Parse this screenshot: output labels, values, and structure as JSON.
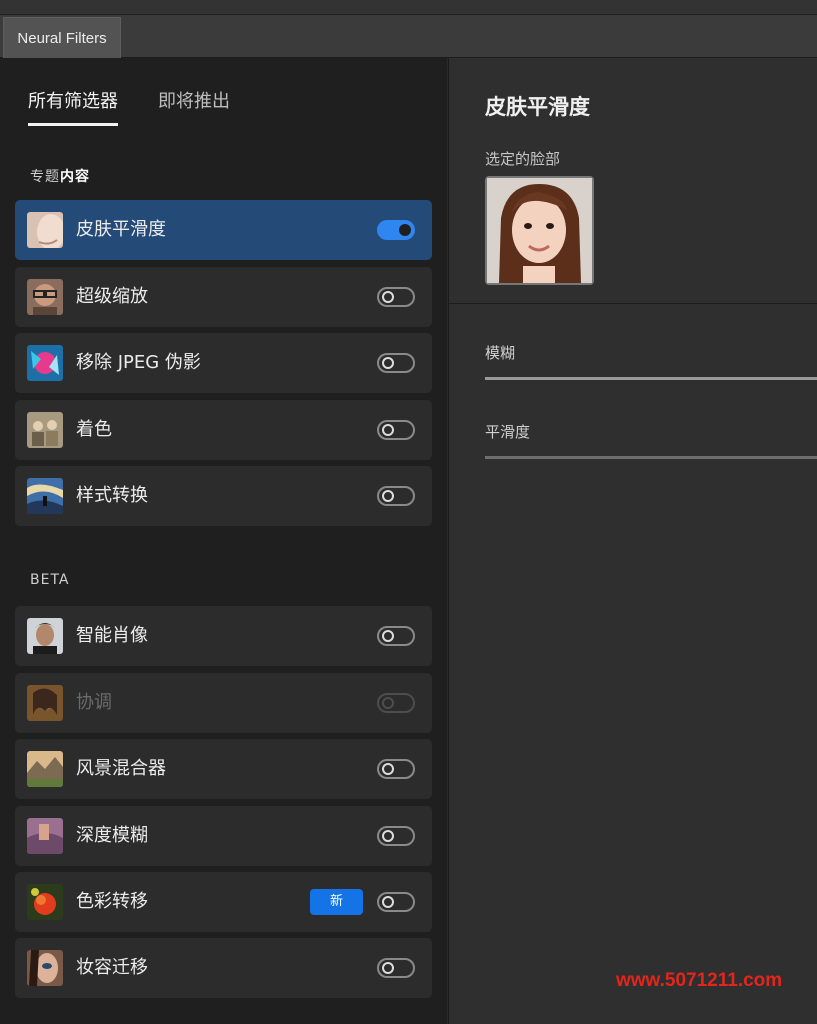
{
  "window": {
    "tab_label": "Neural Filters"
  },
  "filter_tabs": [
    {
      "label": "所有筛选器",
      "active": true
    },
    {
      "label": "即将推出",
      "active": false
    }
  ],
  "sections": [
    {
      "title_prefix": "专题",
      "title_bold": "内容"
    },
    {
      "title": "BETA"
    }
  ],
  "featured": [
    {
      "label": "皮肤平滑度",
      "icon": "skin-smoothing-thumb",
      "enabled": true,
      "selected": true
    },
    {
      "label": "超级缩放",
      "icon": "super-zoom-thumb",
      "enabled": false
    },
    {
      "label": "移除 JPEG 伪影",
      "icon": "jpeg-artifacts-thumb",
      "enabled": false
    },
    {
      "label": "着色",
      "icon": "colorize-thumb",
      "enabled": false
    },
    {
      "label": "样式转换",
      "icon": "style-transfer-thumb",
      "enabled": false
    }
  ],
  "beta": [
    {
      "label": "智能肖像",
      "icon": "smart-portrait-thumb",
      "enabled": false
    },
    {
      "label": "协调",
      "icon": "harmonization-thumb",
      "enabled": false,
      "disabled": true
    },
    {
      "label": "风景混合器",
      "icon": "landscape-mixer-thumb",
      "enabled": false
    },
    {
      "label": "深度模糊",
      "icon": "depth-blur-thumb",
      "enabled": false
    },
    {
      "label": "色彩转移",
      "icon": "color-transfer-thumb",
      "enabled": false,
      "badge": "新"
    },
    {
      "label": "妆容迁移",
      "icon": "makeup-transfer-thumb",
      "enabled": false
    }
  ],
  "panel": {
    "title": "皮肤平滑度",
    "face_label": "选定的脸部",
    "sliders": [
      {
        "label": "模糊"
      },
      {
        "label": "平滑度"
      }
    ]
  },
  "watermark": "www.5071211.com",
  "colors": {
    "accent": "#2f86f0",
    "selected_row": "#244a78",
    "badge": "#1473e6",
    "watermark": "#e1261c"
  }
}
